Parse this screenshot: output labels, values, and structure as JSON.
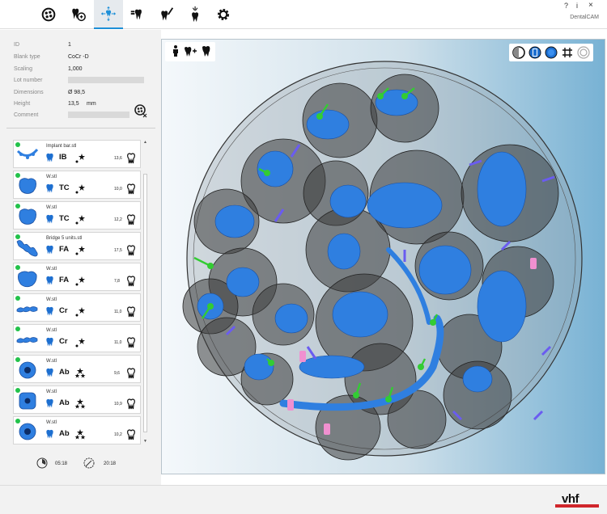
{
  "window": {
    "app_name": "DentalCAM",
    "help_label": "?",
    "info_label": "i",
    "close_label": "×"
  },
  "toolbar": {
    "items": [
      {
        "name": "blank-selection",
        "active": false
      },
      {
        "name": "add-objects",
        "active": false
      },
      {
        "name": "positioning",
        "active": true
      },
      {
        "name": "connectors",
        "active": false
      },
      {
        "name": "calculation",
        "active": false
      },
      {
        "name": "milling",
        "active": false
      },
      {
        "name": "settings",
        "active": false
      }
    ]
  },
  "properties": {
    "id_label": "ID",
    "id_value": "1",
    "blank_type_label": "Blank type",
    "blank_type_value": "CoCr -D",
    "scaling_label": "Scaling",
    "scaling_value": "1,000",
    "lot_label": "Lot number",
    "lot_value": "",
    "dimensions_label": "Dimensions",
    "dimensions_value": "Ø 98,5",
    "height_label": "Height",
    "height_value": "13,5",
    "height_unit": "mm",
    "comment_label": "Comment",
    "comment_value": ""
  },
  "objects": [
    {
      "name": "Implant bar.stl",
      "code": "IB",
      "value": "13,6",
      "stars": 1,
      "thumb": "bar"
    },
    {
      "name": "W.stl",
      "code": "TC",
      "value": "10,0",
      "stars": 1,
      "thumb": "crown"
    },
    {
      "name": "W.stl",
      "code": "TC",
      "value": "12,2",
      "stars": 1,
      "thumb": "crown"
    },
    {
      "name": "Bridge 5 units.stl",
      "code": "FA",
      "value": "17,5",
      "stars": 1,
      "thumb": "bridge"
    },
    {
      "name": "W.stl",
      "code": "FA",
      "value": "7,8",
      "stars": 1,
      "thumb": "crown2"
    },
    {
      "name": "W.stl",
      "code": "Cr",
      "value": "11,0",
      "stars": 1,
      "thumb": "bridge-small"
    },
    {
      "name": "W.stl",
      "code": "Cr",
      "value": "11,0",
      "stars": 1,
      "thumb": "bridge-small"
    },
    {
      "name": "W.stl",
      "code": "Ab",
      "value": "9,6",
      "stars": 2,
      "thumb": "ring"
    },
    {
      "name": "W.stl",
      "code": "Ab",
      "value": "10,9",
      "stars": 2,
      "thumb": "square"
    },
    {
      "name": "W.stl",
      "code": "Ab",
      "value": "10,2",
      "stars": 2,
      "thumb": "ring"
    }
  ],
  "timers": {
    "time_1": "05:18",
    "time_2": "20:18"
  },
  "brand": {
    "logo_text": "vhf",
    "accent_color": "#d0262c"
  },
  "colors": {
    "object_blue": "#2f7fe0",
    "connector_green": "#33cc33",
    "status_green": "#22c24a",
    "viewport_gradient_end": "#78b2d4"
  }
}
